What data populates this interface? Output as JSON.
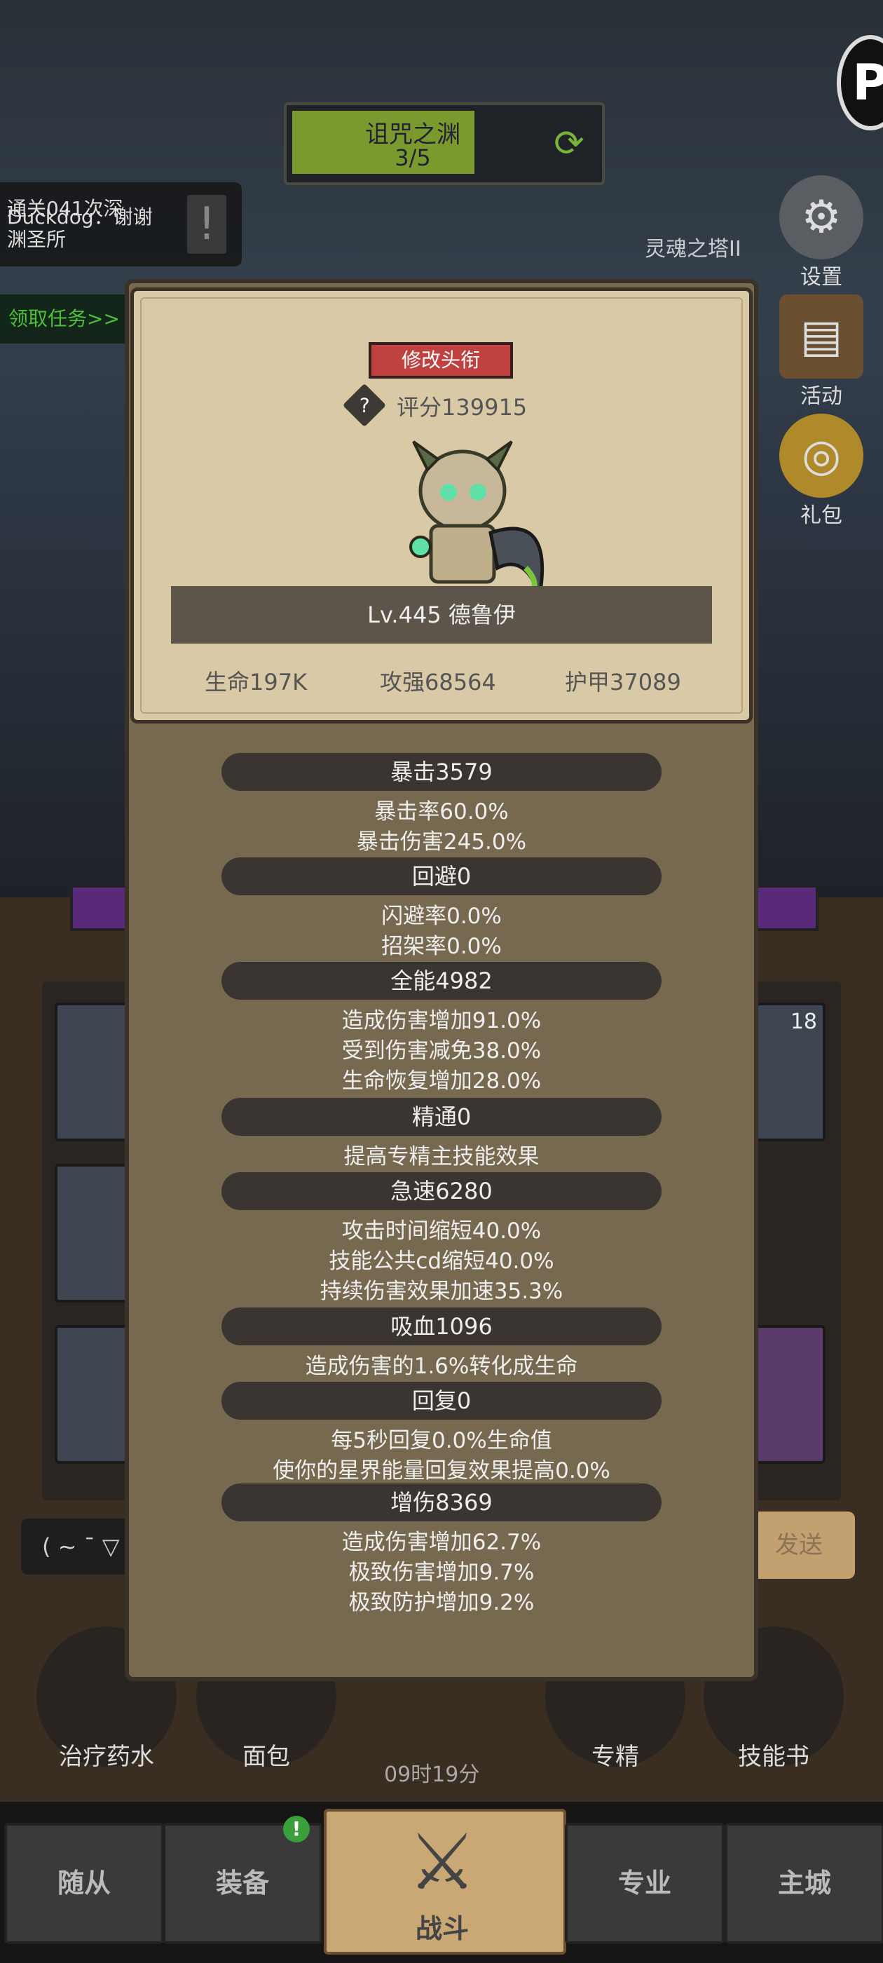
{
  "dungeon": {
    "title": "诅咒之渊",
    "progress_text": "3/5",
    "progress": 0.6
  },
  "chat": {
    "line1": "通关041次深",
    "line2": "Duckdog：谢谢",
    "line3": "渊圣所"
  },
  "quest_link": "领取任务>>",
  "tower": {
    "label": "灵魂之塔II"
  },
  "side_menu": {
    "settings": "设置",
    "events": "活动",
    "gift": "礼包"
  },
  "chat_input": "( ~ ¯ ▽",
  "send_label": "发送",
  "consumables": [
    {
      "label": "治疗药水"
    },
    {
      "label": "面包"
    },
    {
      "label": "专精"
    },
    {
      "label": "技能书"
    }
  ],
  "timer": "09时19分",
  "slot_badge": "18",
  "nav": {
    "followers": "随从",
    "equipment": "装备",
    "battle": "战斗",
    "profession": "专业",
    "city": "主城",
    "badge": "!"
  },
  "profile": {
    "title_button": "修改头衔",
    "score": "评分139915",
    "level_name": "Lv.445 德鲁伊",
    "stats": {
      "hp": "生命197K",
      "attack": "攻强68564",
      "armor": "护甲37089"
    }
  },
  "attributes": [
    {
      "header": "暴击3579",
      "details": [
        "暴击率60.0%",
        "暴击伤害245.0%"
      ]
    },
    {
      "header": "回避0",
      "details": [
        "闪避率0.0%",
        "招架率0.0%"
      ]
    },
    {
      "header": "全能4982",
      "details": [
        "造成伤害增加91.0%",
        "受到伤害减免38.0%",
        "生命恢复增加28.0%"
      ]
    },
    {
      "header": "精通0",
      "details": [
        "提高专精主技能效果"
      ]
    },
    {
      "header": "急速6280",
      "details": [
        "攻击时间缩短40.0%",
        "技能公共cd缩短40.0%",
        "持续伤害效果加速35.3%"
      ]
    },
    {
      "header": "吸血1096",
      "details": [
        "造成伤害的1.6%转化成生命"
      ]
    },
    {
      "header": "回复0",
      "details": [
        "每5秒回复0.0%生命值",
        "使你的星界能量回复效果提高0.0%"
      ]
    },
    {
      "header": "增伤8369",
      "details": [
        "造成伤害增加62.7%",
        "极致伤害增加9.7%",
        "极致防护增加9.2%"
      ]
    }
  ]
}
